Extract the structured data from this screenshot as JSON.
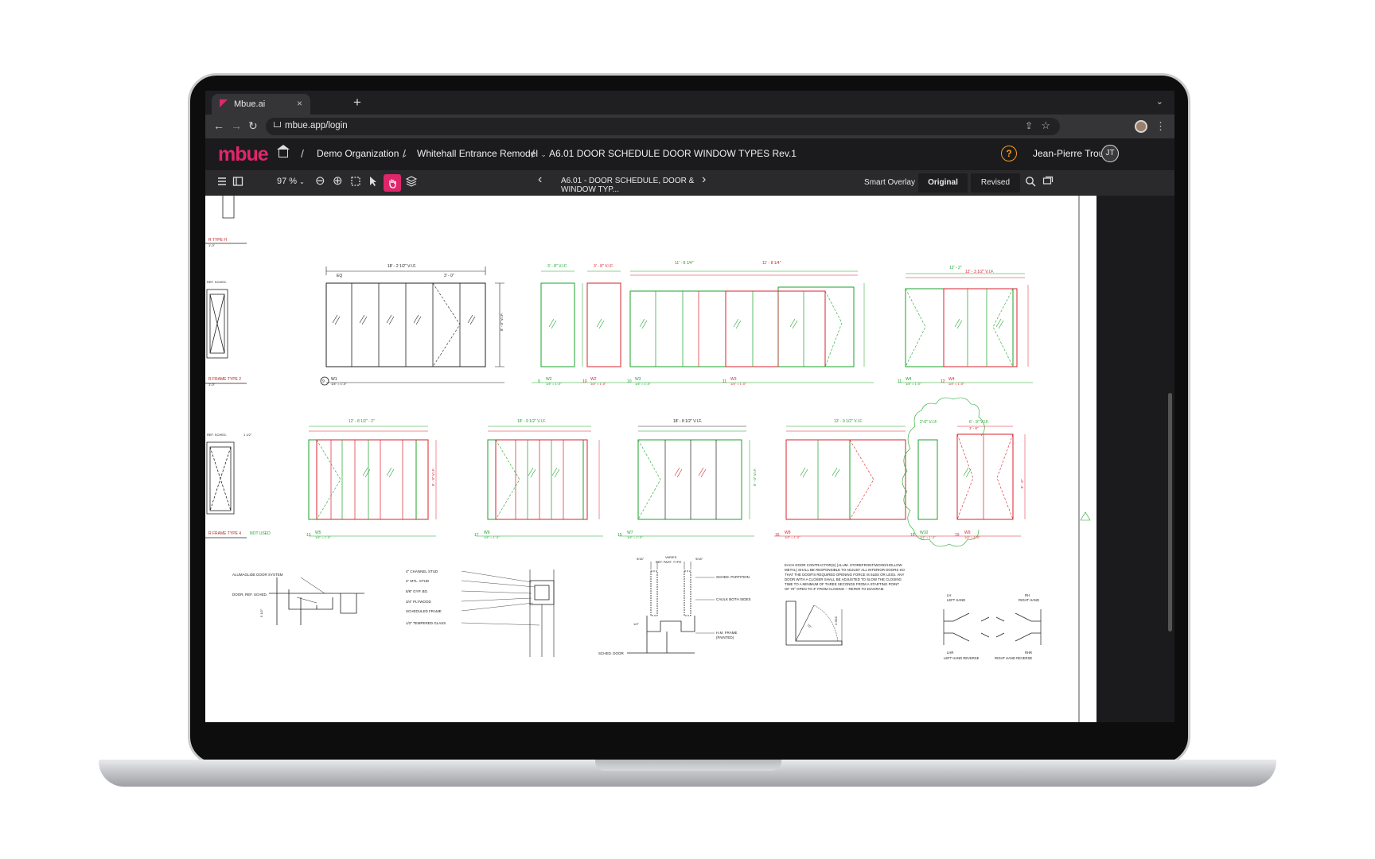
{
  "browser": {
    "tab_title": "Mbue.ai",
    "tab_close": "×",
    "new_tab": "+",
    "tab_menu": "⌄",
    "url": "mbue.app/login",
    "back": "←",
    "forward": "→",
    "reload": "↻",
    "share": "⇪",
    "bookmark": "☆",
    "menu": "⋮"
  },
  "app": {
    "logo": "mbue",
    "breadcrumbs": [
      "Demo Organization",
      "Whitehall Entrance Remodel",
      "A6.01 DOOR SCHEDULE DOOR WINDOW TYPES Rev.1"
    ],
    "crumb_chevron": "⌄",
    "separator": "/",
    "help": "?",
    "user_name": "Jean-Pierre Trou",
    "user_initials": "JT"
  },
  "toolbar": {
    "zoom": "97 %",
    "zoom_chevron": "⌄",
    "zoom_out": "⊖",
    "zoom_in": "⊕",
    "prev": "‹",
    "next": "›",
    "sheet_select": "A6.01 - DOOR SCHEDULE, DOOR & WINDOW TYP...",
    "views": [
      "Smart Overlay",
      "Original",
      "Revised"
    ]
  },
  "drawing": {
    "left_labels": [
      "R TYPE H",
      "1'-0\"",
      "R FRAME TYPE 2",
      "1'-0\"",
      "R FRAME TYPE 4",
      "NOT USED",
      "REF. SCHED.",
      "REF. SCHED.",
      "1 1/2\""
    ],
    "row1": [
      {
        "num": "9",
        "tag": "W1",
        "scale": "1/4\" = 1'-0\"",
        "overall": "18' - 2 1/2\" V.I.F.",
        "height": "8' - 0\" V.I.F."
      },
      {
        "num": "9",
        "tag": "W2",
        "scale": "1/4\" = 1'-0\"",
        "overall": "3' - 8\" V.I.F."
      },
      {
        "num": "10",
        "tag": "W2",
        "scale": "1/4\" = 1'-0\"",
        "overall": "3' - 8\" V.I.F."
      },
      {
        "num": "10",
        "tag": "W3",
        "scale": "1/4\" = 1'-0\"",
        "overall": "11' - 8 1/4\""
      },
      {
        "num": "11",
        "tag": "W3",
        "scale": "1/4\" = 1'-0\"",
        "overall": "11' - 8 1/4\""
      },
      {
        "num": "12",
        "tag": "W4",
        "scale": "1/4\" = 1'-0\"",
        "overall": "12' - 2\""
      },
      {
        "num": "11",
        "tag": "W4",
        "scale": "1/4\" = 1'-0\""
      },
      {
        "num": "12",
        "tag": "W4",
        "scale": "1/4\" = 1'-0\"",
        "overall": "12' - 3 1/2\" V.I.F."
      }
    ],
    "row2": [
      {
        "num": "13",
        "tag": "W5",
        "scale": "1/4\" = 1'-0\"",
        "overall": "12' - 8 1/2\" - 2\""
      },
      {
        "num": "17",
        "tag": "W6",
        "scale": "1/4\" = 1'-0\"",
        "overall": "18' - 9 1/2\" V.I.F."
      },
      {
        "num": "15",
        "tag": "W7",
        "scale": "1/4\" = 1'-0\"",
        "overall": "18' - 8 1/2\" V.I.F."
      },
      {
        "num": "16",
        "tag": "W8",
        "scale": "1/4\" = 1'-0\"",
        "overall": "13' - 9 1/2\" V.I.F."
      },
      {
        "num": "18",
        "tag": "W10",
        "scale": "1/4\" = 1'-0\"",
        "overall": "2'-0\" V.I.F."
      },
      {
        "num": "19",
        "tag": "W9",
        "scale": "1/4\" = 1'-0\"",
        "overall": "6' - 9\" V.I.F."
      }
    ],
    "dims": [
      "EQ",
      "3' - 0\"",
      "8' - 8\" V.I.F.",
      "8' - 0\" V.I.F.",
      "8' - 6\"",
      "3' - 8\""
    ],
    "detail1": [
      "ALUMAGLIDE DOOR SYSTEM",
      "DOOR, REF. SCHED.",
      "5 1/2\""
    ],
    "detail2": [
      "4\" CHANNEL STUD",
      "4\" MTL. STUD",
      "5/8\" GYP. BD.",
      "3/4\" PLYWOOD",
      "SCHEDULED FRAME",
      "1/2\" TEMPERED GLASS"
    ],
    "detail3": [
      "9/16\"",
      "VARIES",
      "REF. PART. TYPE",
      "9/16\"",
      "SCHED. PARTITION",
      "CAULK BOTH SIDES",
      "H.M. FRAME",
      "(PAINTED)",
      "SCHED. DOOR",
      "1/2\""
    ],
    "note": [
      "EACH DOOR CONTRACTOR(S) (ALUM. STOREFRONT/WOOD/HOLLOW",
      "METAL) SHALL BE RESPONSIBLE TO ADJUST ALL INTERIOR DOORS SO",
      "THAT THE DOOR'S REQUIRED OPENING FORCE IS 5LBS OR LESS. ANY",
      "DOOR WITH A CLOSER SHALL BE ADJUSTED TO SLOW THE CLOSING",
      "TIME TO A MINIMUM OF THREE SECONDS FROM A STARTING POINT",
      "OF 70° OPEN TO 3\" FROM CLOSING -- REFER TO DIAGRAM."
    ],
    "closer": [
      "70°",
      "3 SEC"
    ],
    "hand": [
      "LH",
      "LEFT HAND",
      "RH",
      "RIGHT HAND",
      "LHR",
      "RHR",
      "LEFT HAND REVERSE",
      "RIGHT HAND REVERSE"
    ]
  },
  "colors": {
    "accent": "#e0266b",
    "match": "#1aa329",
    "changed": "#d9212e",
    "help": "#f29b22"
  }
}
